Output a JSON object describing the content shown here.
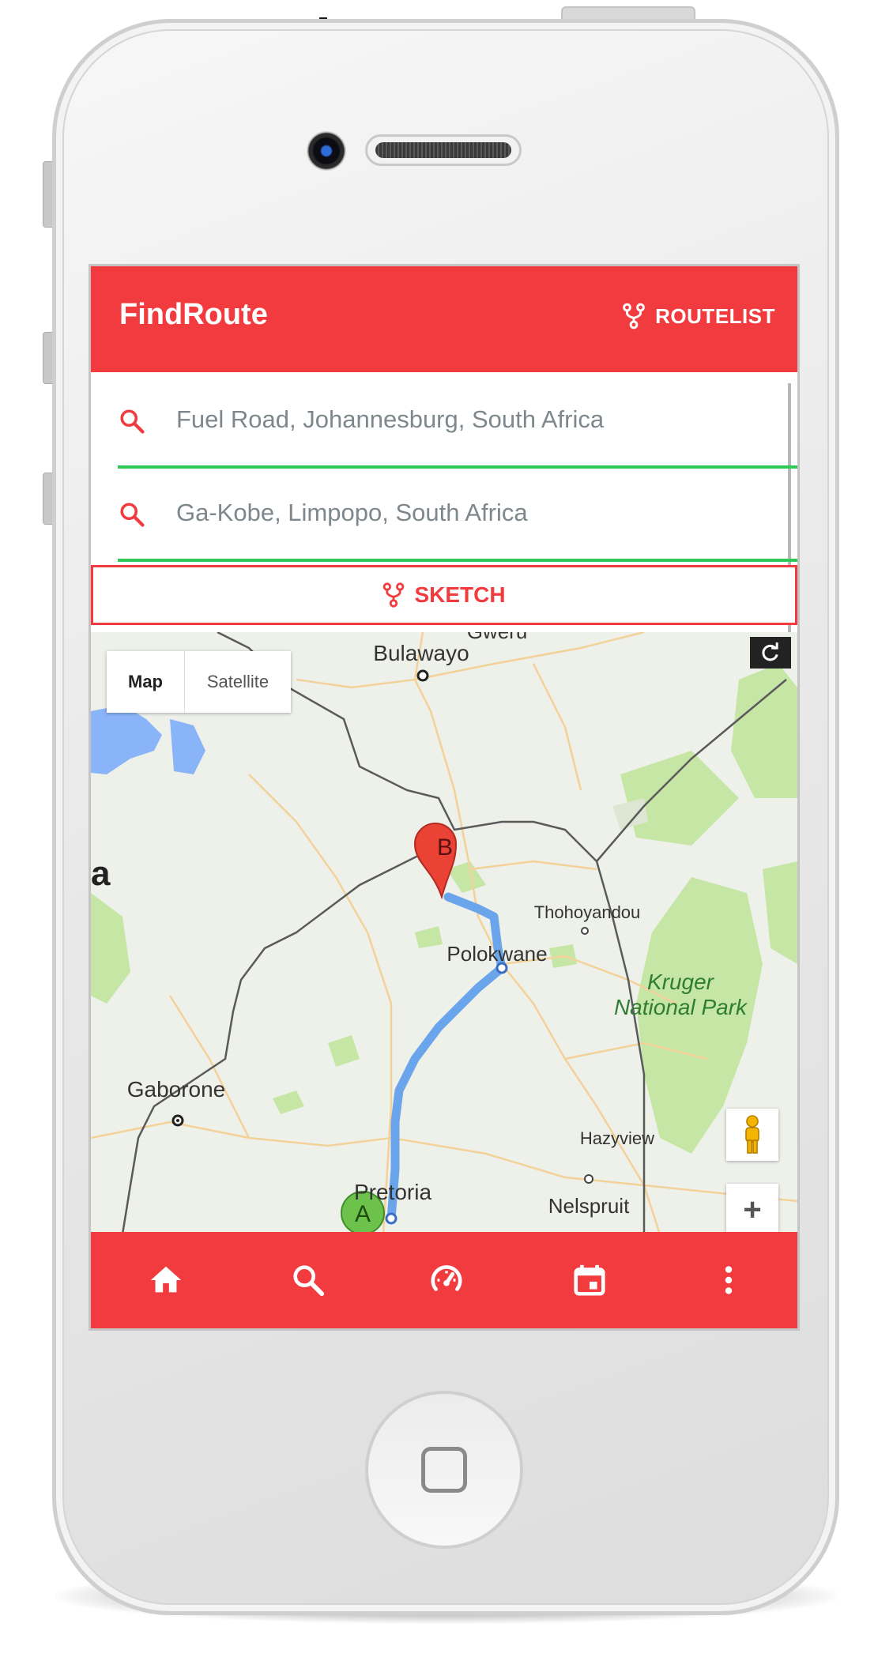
{
  "app": {
    "title": "FindRoute",
    "routelist_label": "ROUTELIST"
  },
  "search": {
    "from_value": "Fuel Road, Johannesburg, South Africa",
    "to_value": "Ga-Kobe, Limpopo, South Africa"
  },
  "sketch_label": "SKETCH",
  "map": {
    "toggle_map": "Map",
    "toggle_satellite": "Satellite",
    "labels": {
      "gweru": "Gweru",
      "bulawayo": "Bulawayo",
      "partial_a": "a",
      "thohoyandou": "Thohoyandou",
      "polokwane": "Polokwane",
      "kruger_1": "Kruger",
      "kruger_2": "National Park",
      "gaborone": "Gaborone",
      "hazyview": "Hazyview",
      "pretoria": "Pretoria",
      "nelspruit": "Nelspruit",
      "marker_a": "A",
      "marker_b": "B"
    },
    "zoom_symbol": "+"
  },
  "bottom_nav": [
    "home-icon",
    "search-icon",
    "speedometer-icon",
    "calendar-icon",
    "more-vert-icon"
  ],
  "colors": {
    "accent": "#f23b3f",
    "field_underline": "#2fca56",
    "route": "#4a90e2"
  }
}
